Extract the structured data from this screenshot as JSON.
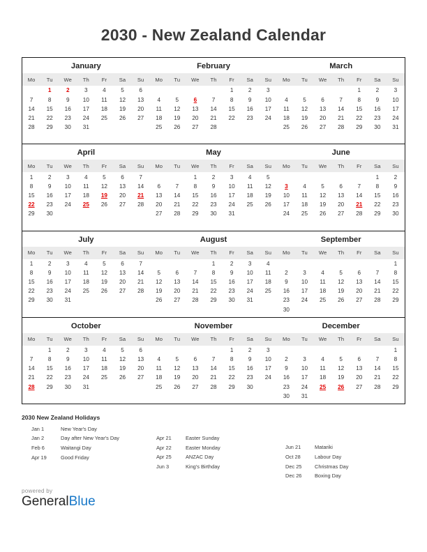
{
  "page": {
    "title": "2030 - New Zealand Calendar",
    "year": "2030"
  },
  "weekday_headers": [
    "Mo",
    "Tu",
    "We",
    "Th",
    "Fr",
    "Sa",
    "Su"
  ],
  "colors": {
    "holiday": "#e00000",
    "text": "#333333",
    "header_band": "#ebebeb",
    "brand_blue": "#1878c8",
    "border": "#1a1a1a"
  },
  "quarters": [
    {
      "months": [
        {
          "name": "January",
          "weeks": [
            [
              "",
              "1",
              "2",
              "3",
              "4",
              "5",
              "6"
            ],
            [
              "7",
              "8",
              "9",
              "10",
              "11",
              "12",
              "13"
            ],
            [
              "14",
              "15",
              "16",
              "17",
              "18",
              "19",
              "20"
            ],
            [
              "21",
              "22",
              "23",
              "24",
              "25",
              "26",
              "27"
            ],
            [
              "28",
              "29",
              "30",
              "31",
              "",
              "",
              ""
            ],
            [
              "",
              "",
              "",
              "",
              "",
              "",
              ""
            ]
          ],
          "holidays": [
            "1",
            "2"
          ],
          "holidays_underlined": []
        },
        {
          "name": "February",
          "weeks": [
            [
              "",
              "",
              "",
              "",
              "1",
              "2",
              "3"
            ],
            [
              "4",
              "5",
              "6",
              "7",
              "8",
              "9",
              "10"
            ],
            [
              "11",
              "12",
              "13",
              "14",
              "15",
              "16",
              "17"
            ],
            [
              "18",
              "19",
              "20",
              "21",
              "22",
              "23",
              "24"
            ],
            [
              "25",
              "26",
              "27",
              "28",
              "",
              "",
              ""
            ],
            [
              "",
              "",
              "",
              "",
              "",
              "",
              ""
            ]
          ],
          "holidays": [
            "6"
          ],
          "holidays_underlined": [
            "6"
          ]
        },
        {
          "name": "March",
          "weeks": [
            [
              "",
              "",
              "",
              "",
              "1",
              "2",
              "3"
            ],
            [
              "4",
              "5",
              "6",
              "7",
              "8",
              "9",
              "10"
            ],
            [
              "11",
              "12",
              "13",
              "14",
              "15",
              "16",
              "17"
            ],
            [
              "18",
              "19",
              "20",
              "21",
              "22",
              "23",
              "24"
            ],
            [
              "25",
              "26",
              "27",
              "28",
              "29",
              "30",
              "31"
            ],
            [
              "",
              "",
              "",
              "",
              "",
              "",
              ""
            ]
          ],
          "holidays": [],
          "holidays_underlined": []
        }
      ]
    },
    {
      "months": [
        {
          "name": "April",
          "weeks": [
            [
              "1",
              "2",
              "3",
              "4",
              "5",
              "6",
              "7"
            ],
            [
              "8",
              "9",
              "10",
              "11",
              "12",
              "13",
              "14"
            ],
            [
              "15",
              "16",
              "17",
              "18",
              "19",
              "20",
              "21"
            ],
            [
              "22",
              "23",
              "24",
              "25",
              "26",
              "27",
              "28"
            ],
            [
              "29",
              "30",
              "",
              "",
              "",
              "",
              ""
            ],
            [
              "",
              "",
              "",
              "",
              "",
              "",
              ""
            ]
          ],
          "holidays": [
            "19",
            "21",
            "22",
            "25"
          ],
          "holidays_underlined": [
            "19",
            "21",
            "22",
            "25"
          ]
        },
        {
          "name": "May",
          "weeks": [
            [
              "",
              "",
              "1",
              "2",
              "3",
              "4",
              "5"
            ],
            [
              "6",
              "7",
              "8",
              "9",
              "10",
              "11",
              "12"
            ],
            [
              "13",
              "14",
              "15",
              "16",
              "17",
              "18",
              "19"
            ],
            [
              "20",
              "21",
              "22",
              "23",
              "24",
              "25",
              "26"
            ],
            [
              "27",
              "28",
              "29",
              "30",
              "31",
              "",
              ""
            ],
            [
              "",
              "",
              "",
              "",
              "",
              "",
              ""
            ]
          ],
          "holidays": [],
          "holidays_underlined": []
        },
        {
          "name": "June",
          "weeks": [
            [
              "",
              "",
              "",
              "",
              "",
              "1",
              "2"
            ],
            [
              "3",
              "4",
              "5",
              "6",
              "7",
              "8",
              "9"
            ],
            [
              "10",
              "11",
              "12",
              "13",
              "14",
              "15",
              "16"
            ],
            [
              "17",
              "18",
              "19",
              "20",
              "21",
              "22",
              "23"
            ],
            [
              "24",
              "25",
              "26",
              "27",
              "28",
              "29",
              "30"
            ],
            [
              "",
              "",
              "",
              "",
              "",
              "",
              ""
            ]
          ],
          "holidays": [
            "3",
            "21"
          ],
          "holidays_underlined": [
            "3",
            "21"
          ]
        }
      ]
    },
    {
      "months": [
        {
          "name": "July",
          "weeks": [
            [
              "1",
              "2",
              "3",
              "4",
              "5",
              "6",
              "7"
            ],
            [
              "8",
              "9",
              "10",
              "11",
              "12",
              "13",
              "14"
            ],
            [
              "15",
              "16",
              "17",
              "18",
              "19",
              "20",
              "21"
            ],
            [
              "22",
              "23",
              "24",
              "25",
              "26",
              "27",
              "28"
            ],
            [
              "29",
              "30",
              "31",
              "",
              "",
              "",
              ""
            ],
            [
              "",
              "",
              "",
              "",
              "",
              "",
              ""
            ]
          ],
          "holidays": [],
          "holidays_underlined": []
        },
        {
          "name": "August",
          "weeks": [
            [
              "",
              "",
              "",
              "1",
              "2",
              "3",
              "4"
            ],
            [
              "5",
              "6",
              "7",
              "8",
              "9",
              "10",
              "11"
            ],
            [
              "12",
              "13",
              "14",
              "15",
              "16",
              "17",
              "18"
            ],
            [
              "19",
              "20",
              "21",
              "22",
              "23",
              "24",
              "25"
            ],
            [
              "26",
              "27",
              "28",
              "29",
              "30",
              "31",
              ""
            ],
            [
              "",
              "",
              "",
              "",
              "",
              "",
              ""
            ]
          ],
          "holidays": [],
          "holidays_underlined": []
        },
        {
          "name": "September",
          "weeks": [
            [
              "",
              "",
              "",
              "",
              "",
              "",
              "1"
            ],
            [
              "2",
              "3",
              "4",
              "5",
              "6",
              "7",
              "8"
            ],
            [
              "9",
              "10",
              "11",
              "12",
              "13",
              "14",
              "15"
            ],
            [
              "16",
              "17",
              "18",
              "19",
              "20",
              "21",
              "22"
            ],
            [
              "23",
              "24",
              "25",
              "26",
              "27",
              "28",
              "29"
            ],
            [
              "30",
              "",
              "",
              "",
              "",
              "",
              ""
            ]
          ],
          "holidays": [],
          "holidays_underlined": []
        }
      ]
    },
    {
      "months": [
        {
          "name": "October",
          "weeks": [
            [
              "",
              "1",
              "2",
              "3",
              "4",
              "5",
              "6"
            ],
            [
              "7",
              "8",
              "9",
              "10",
              "11",
              "12",
              "13"
            ],
            [
              "14",
              "15",
              "16",
              "17",
              "18",
              "19",
              "20"
            ],
            [
              "21",
              "22",
              "23",
              "24",
              "25",
              "26",
              "27"
            ],
            [
              "28",
              "29",
              "30",
              "31",
              "",
              "",
              ""
            ],
            [
              "",
              "",
              "",
              "",
              "",
              "",
              ""
            ]
          ],
          "holidays": [
            "28"
          ],
          "holidays_underlined": [
            "28"
          ]
        },
        {
          "name": "November",
          "weeks": [
            [
              "",
              "",
              "",
              "",
              "1",
              "2",
              "3"
            ],
            [
              "4",
              "5",
              "6",
              "7",
              "8",
              "9",
              "10"
            ],
            [
              "11",
              "12",
              "13",
              "14",
              "15",
              "16",
              "17"
            ],
            [
              "18",
              "19",
              "20",
              "21",
              "22",
              "23",
              "24"
            ],
            [
              "25",
              "26",
              "27",
              "28",
              "29",
              "30",
              ""
            ],
            [
              "",
              "",
              "",
              "",
              "",
              "",
              ""
            ]
          ],
          "holidays": [],
          "holidays_underlined": []
        },
        {
          "name": "December",
          "weeks": [
            [
              "",
              "",
              "",
              "",
              "",
              "",
              "1"
            ],
            [
              "2",
              "3",
              "4",
              "5",
              "6",
              "7",
              "8"
            ],
            [
              "9",
              "10",
              "11",
              "12",
              "13",
              "14",
              "15"
            ],
            [
              "16",
              "17",
              "18",
              "19",
              "20",
              "21",
              "22"
            ],
            [
              "23",
              "24",
              "25",
              "26",
              "27",
              "28",
              "29"
            ],
            [
              "30",
              "31",
              "",
              "",
              "",
              "",
              ""
            ]
          ],
          "holidays": [
            "25",
            "26"
          ],
          "holidays_underlined": [
            "25",
            "26"
          ]
        }
      ]
    }
  ],
  "holidays_section": {
    "title": "2030 New Zealand Holidays",
    "columns": [
      [
        {
          "date": "Jan 1",
          "name": "New Year's Day"
        },
        {
          "date": "Jan 2",
          "name": "Day after New Year's Day"
        },
        {
          "date": "Feb 6",
          "name": "Waitangi Day"
        },
        {
          "date": "Apr 19",
          "name": "Good Friday"
        }
      ],
      [
        {
          "date": "Apr 21",
          "name": "Easter Sunday"
        },
        {
          "date": "Apr 22",
          "name": "Easter Monday"
        },
        {
          "date": "Apr 25",
          "name": "ANZAC Day"
        },
        {
          "date": "Jun 3",
          "name": "King's Birthday"
        }
      ],
      [
        {
          "date": "Jun 21",
          "name": "Matariki"
        },
        {
          "date": "Oct 28",
          "name": "Labour Day"
        },
        {
          "date": "Dec 25",
          "name": "Christmas Day"
        },
        {
          "date": "Dec 26",
          "name": "Boxing Day"
        }
      ]
    ]
  },
  "footer": {
    "powered_by": "powered by",
    "brand_first": "General",
    "brand_second": "Blue"
  }
}
